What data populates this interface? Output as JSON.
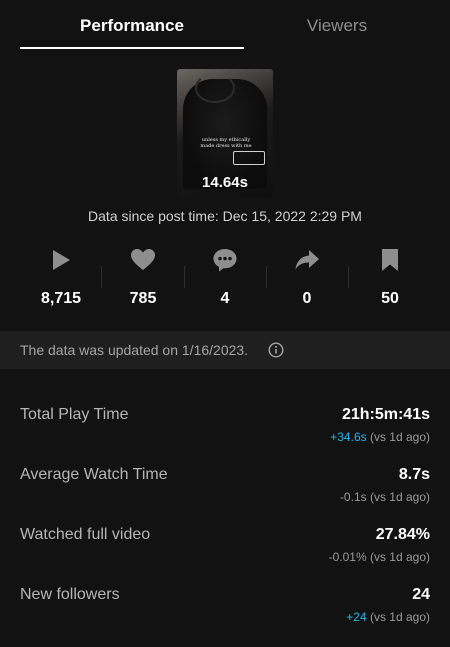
{
  "tabs": {
    "performance": "Performance",
    "viewers": "Viewers"
  },
  "video": {
    "caption": "unless my ethically made dress with me",
    "duration": "14.64s"
  },
  "data_since": "Data since post time: Dec 15, 2022 2:29 PM",
  "stats": [
    {
      "icon": "play-icon",
      "value": "8,715"
    },
    {
      "icon": "heart-icon",
      "value": "785"
    },
    {
      "icon": "comment-icon",
      "value": "4"
    },
    {
      "icon": "share-icon",
      "value": "0"
    },
    {
      "icon": "bookmark-icon",
      "value": "50"
    }
  ],
  "banner": {
    "text": "The data was updated on 1/16/2023.",
    "icon": "info-icon"
  },
  "metrics": [
    {
      "label": "Total Play Time",
      "value": "21h:5m:41s",
      "delta": "+34.6s",
      "compare": " (vs 1d ago)"
    },
    {
      "label": "Average Watch Time",
      "value": "8.7s",
      "delta": "-0.1s",
      "compare": " (vs 1d ago)"
    },
    {
      "label": "Watched full video",
      "value": "27.84%",
      "delta": "-0.01%",
      "compare": " (vs 1d ago)"
    },
    {
      "label": "New followers",
      "value": "24",
      "delta": "+24",
      "compare": " (vs 1d ago)"
    }
  ],
  "colors": {
    "background": "#121212",
    "positive_delta": "#2fb3e8",
    "icon": "#8e8e8e"
  }
}
